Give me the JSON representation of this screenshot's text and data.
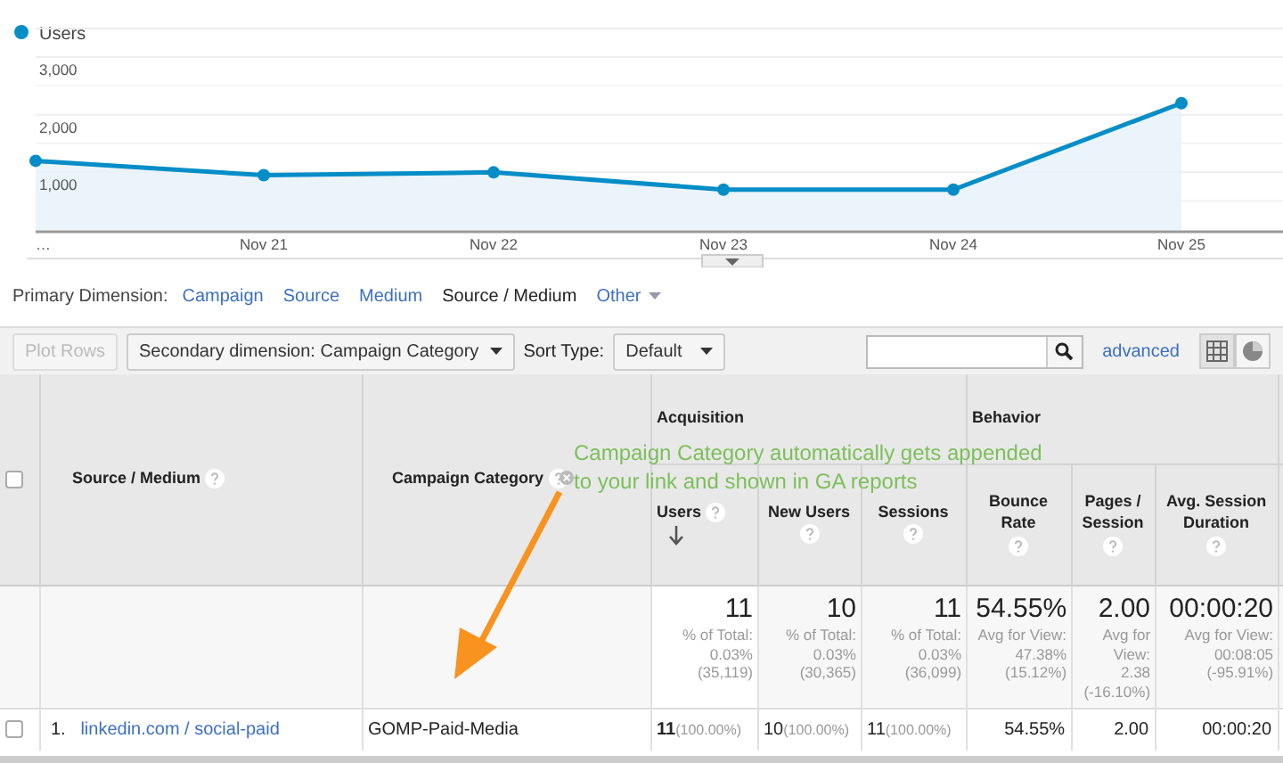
{
  "chart": {
    "chart_data": {
      "type": "area",
      "categories": [
        "…",
        "Nov 21",
        "Nov 22",
        "Nov 23",
        "Nov 24",
        "Nov 25"
      ],
      "series": [
        {
          "name": "Users",
          "color": "#058dc7",
          "marker": true,
          "values": [
            1200,
            950,
            1000,
            700,
            700,
            2200
          ]
        }
      ],
      "ylim": [
        0,
        3000
      ],
      "yticks": [
        {
          "value": 1000,
          "label": "1,000"
        },
        {
          "value": 2000,
          "label": "2,000"
        },
        {
          "value": 3000,
          "label": "3,000"
        }
      ]
    }
  },
  "primary_dimension": {
    "label": "Primary Dimension:",
    "options": [
      {
        "label": "Campaign",
        "selected": false,
        "dropdown": false
      },
      {
        "label": "Source",
        "selected": false,
        "dropdown": false
      },
      {
        "label": "Medium",
        "selected": false,
        "dropdown": false
      },
      {
        "label": "Source / Medium",
        "selected": true,
        "dropdown": false
      },
      {
        "label": "Other",
        "selected": false,
        "dropdown": true
      }
    ]
  },
  "toolbar": {
    "plot_rows": {
      "label": "Plot Rows",
      "disabled": true
    },
    "secondary_dimension": "Secondary dimension: Campaign Category",
    "sort_type_label": "Sort Type:",
    "sort_type": "Default",
    "advanced": "advanced",
    "views": [
      {
        "kind": "table",
        "selected": true
      },
      {
        "kind": "pie",
        "selected": false
      }
    ]
  },
  "table": {
    "header_checked": false,
    "dimension_columns": [
      "Source / Medium",
      "Campaign Category"
    ],
    "groups": [
      {
        "label": "Acquisition",
        "columns": [
          {
            "label": "Users",
            "sorted": true
          },
          {
            "label": "New Users",
            "sorted": false
          },
          {
            "label": "Sessions",
            "sorted": false
          }
        ]
      },
      {
        "label": "Behavior",
        "columns": [
          {
            "label": "Bounce Rate",
            "sorted": false
          },
          {
            "label": "Pages / Session",
            "sorted": false
          },
          {
            "label": "Avg. Session Duration",
            "sorted": false
          }
        ]
      }
    ],
    "totals": [
      {
        "value": "11",
        "lines": [
          "% of Total:",
          "0.03%",
          "(35,119)"
        ]
      },
      {
        "value": "10",
        "lines": [
          "% of Total:",
          "0.03%",
          "(30,365)"
        ]
      },
      {
        "value": "11",
        "lines": [
          "% of Total:",
          "0.03%",
          "(36,099)"
        ]
      },
      {
        "value": "54.55%",
        "lines": [
          "Avg for View:",
          "47.38%",
          "(15.12%)"
        ]
      },
      {
        "value": "2.00",
        "lines": [
          "Avg for",
          "View:",
          "2.38",
          "(-16.10%)"
        ]
      },
      {
        "value": "00:00:20",
        "lines": [
          "Avg for View:",
          "00:08:05",
          "(-95.91%)"
        ]
      }
    ],
    "rows": [
      {
        "index": "1.",
        "checked": false,
        "source_medium": "linkedin.com / social-paid",
        "campaign_category": "GOMP-Paid-Media",
        "metrics": [
          {
            "value": "11",
            "share": "(100.00%)"
          },
          {
            "value": "10",
            "share": "(100.00%)"
          },
          {
            "value": "11",
            "share": "(100.00%)"
          },
          {
            "value": "54.55%"
          },
          {
            "value": "2.00"
          },
          {
            "value": "00:00:20"
          }
        ]
      }
    ]
  },
  "annotation": {
    "text": "Campaign Category automatically gets appended to your link and shown in GA reports"
  }
}
